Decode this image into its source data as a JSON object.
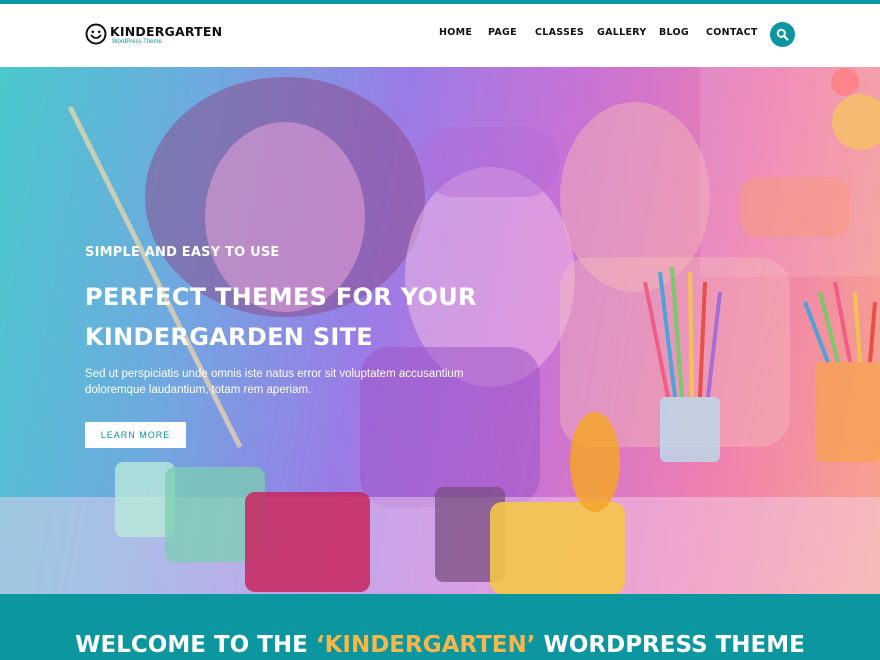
{
  "brand": {
    "name": "KINDERGARTEN",
    "tagline": "WordPress Theme",
    "accent": "#0b96a0"
  },
  "nav": {
    "items": [
      {
        "label": "HOME"
      },
      {
        "label": "PAGE"
      },
      {
        "label": "CLASSES"
      },
      {
        "label": "GALLERY"
      },
      {
        "label": "BLOG"
      },
      {
        "label": "CONTACT"
      }
    ],
    "search_icon": "search-icon"
  },
  "hero": {
    "kicker": "SIMPLE AND EASY TO USE",
    "title_line1": "PERFECT THEMES FOR YOUR",
    "title_line2": "KINDERGARDEN SITE",
    "text_line1": "Sed ut perspiciatis unde omnis iste natus error sit voluptatem accusantium",
    "text_line2": "doloremque laudantium, totam rem aperiam.",
    "button_label": "LEARN MORE"
  },
  "welcome": {
    "title_pre": "WELCOME TO THE ",
    "title_highlight": "‘KINDERGARTEN’",
    "title_post": " WORDPRESS THEME",
    "highlight_color": "#f6b64a"
  }
}
